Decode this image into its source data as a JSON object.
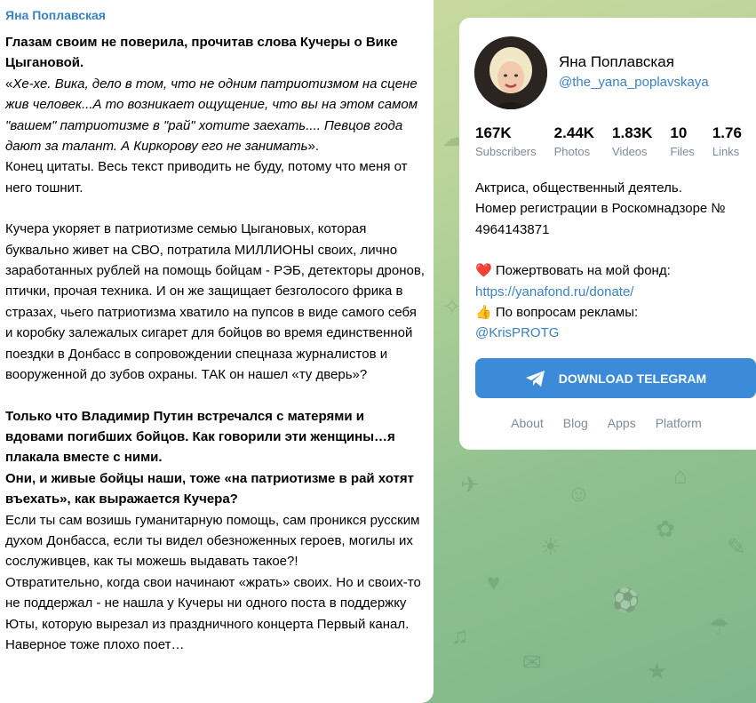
{
  "post": {
    "author": "Яна Поплавская",
    "paragraphs": [
      {
        "type": "b",
        "text": "Глазам своим не поверила, прочитав слова Кучеры о Вике Цыгановой."
      },
      {
        "type": "mix",
        "pre": "«",
        "italic": "Хе-хе. Вика, дело в том, что не одним патриотизмом на сцене жив человек...А то возникает ощущение, что вы на этом самом \"вашем\" патриотизме в \"рай\" хотите заехать.... Певцов года дают за талант. А Киркорову его не занимать",
        "post": "»."
      },
      {
        "type": "n",
        "text": "Конец цитаты. Весь текст приводить не буду, потому что меня от него тошнит."
      },
      {
        "type": "gap"
      },
      {
        "type": "n",
        "text": "Кучера укоряет в патриотизме семью Цыгановых, которая буквально живет на СВО, потратила МИЛЛИОНЫ своих, лично заработанных рублей на помощь бойцам - РЭБ, детекторы дронов, птички, прочая техника. И он же защищает безголосого фрика в стразах, чьего патриотизма хватило на пупсов в виде самого себя и коробку залежалых сигарет для бойцов во время единственной поездки в Донбасс в сопровождении спецназа журналистов и вооруженной до зубов охраны. ТАК он нашел «ту дверь»?"
      },
      {
        "type": "gap"
      },
      {
        "type": "b",
        "text": "Только что Владимир Путин встречался с матерями и вдовами погибших бойцов. Как говорили эти женщины…я плакала вместе с ними."
      },
      {
        "type": "b",
        "text": "Они, и живые бойцы наши, тоже «на патриотизме в рай хотят въехать», как выражается Кучера?"
      },
      {
        "type": "n",
        "text": "Если ты сам возишь гуманитарную помощь, сам проникся русским духом Донбасса, если ты видел обезноженных героев, могилы их сослуживцев, как ты можешь выдавать такое?!"
      },
      {
        "type": "n",
        "text": "Отвратительно, когда свои начинают «жрать» своих. Но и своих-то не поддержал - не нашла у Кучеры ни одного поста в поддержку Юты, которую вырезал из праздничного концерта Первый канал. Наверное тоже плохо поет…"
      }
    ]
  },
  "channel": {
    "name": "Яна Поплавская",
    "username": "@the_yana_poplavskaya",
    "stats": [
      {
        "value": "167K",
        "label": "Subscribers"
      },
      {
        "value": "2.44K",
        "label": "Photos"
      },
      {
        "value": "1.83K",
        "label": "Videos"
      },
      {
        "value": "10",
        "label": "Files"
      },
      {
        "value": "1.76",
        "label": "Links"
      }
    ],
    "description": {
      "line1": "Актриса, общественный деятель.",
      "line2": "Номер регистрации в Роскомнадзоре № 4964143871",
      "donate_icon": "❤️",
      "donate_label": "Пожертвовать на мой фонд:",
      "donate_link": "https://yanafond.ru/donate/",
      "ads_icon": "👍",
      "ads_label": "По вопросам рекламы:",
      "ads_link": "@KrisPROTG"
    },
    "download_label": "DOWNLOAD TELEGRAM",
    "footer_links": [
      "About",
      "Blog",
      "Apps",
      "Platform"
    ]
  },
  "colors": {
    "accent": "#3a82c4",
    "button": "#3b8bd9",
    "muted": "#7f8a96"
  }
}
